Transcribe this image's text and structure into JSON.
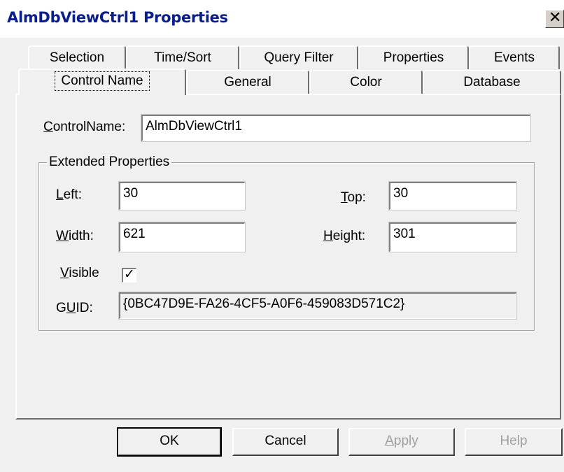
{
  "window": {
    "title": "AlmDbViewCtrl1 Properties",
    "close_glyph": "✕"
  },
  "tabs_back_row": [
    {
      "label": "Selection"
    },
    {
      "label": "Time/Sort"
    },
    {
      "label": "Query Filter"
    },
    {
      "label": "Properties"
    },
    {
      "label": "Events"
    }
  ],
  "tabs_front_row": [
    {
      "label": "Control Name",
      "active": true
    },
    {
      "label": "General"
    },
    {
      "label": "Color"
    },
    {
      "label": "Database"
    }
  ],
  "control_name": {
    "label": "ControlName:",
    "value": "AlmDbViewCtrl1"
  },
  "extended": {
    "group_title": "Extended Properties",
    "left_label": "Left:",
    "left_value": "30",
    "top_label": "Top:",
    "top_value": "30",
    "width_label": "Width:",
    "width_value": "621",
    "height_label": "Height:",
    "height_value": "301",
    "visible_label": "Visible",
    "visible_checked": true,
    "guid_label": "GUID:",
    "guid_value": "{0BC47D9E-FA26-4CF5-A0F6-459083D571C2}"
  },
  "buttons": {
    "ok": "OK",
    "cancel": "Cancel",
    "apply": "Apply",
    "help": "Help"
  },
  "colors": {
    "title_text": "#0a1f8c",
    "dialog_bg": "#f0f0f0",
    "disabled_text": "#a0a0a0"
  },
  "icons": {
    "close": "close-icon",
    "check": "checkmark-icon"
  }
}
